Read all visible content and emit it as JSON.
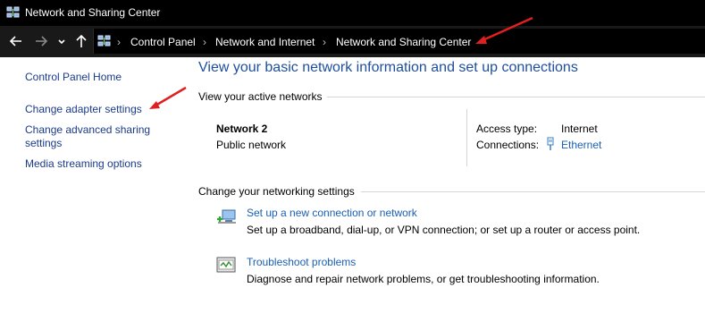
{
  "window": {
    "title": "Network and Sharing Center",
    "icon": "network-center-icon"
  },
  "nav": {
    "back_icon": "back-arrow-icon",
    "forward_icon": "forward-arrow-icon",
    "recent_icon": "chevron-down-icon",
    "up_icon": "up-arrow-icon",
    "breadcrumb": [
      "Control Panel",
      "Network and Internet",
      "Network and Sharing Center"
    ]
  },
  "sidebar": {
    "items": [
      {
        "label": "Control Panel Home"
      },
      {
        "label": "Change adapter settings"
      },
      {
        "label": "Change advanced sharing settings"
      },
      {
        "label": "Media streaming options"
      }
    ]
  },
  "main": {
    "heading": "View your basic network information and set up connections",
    "active_label": "View your active networks",
    "network": {
      "name": "Network 2",
      "type": "Public network",
      "access_type_label": "Access type:",
      "access_type_value": "Internet",
      "connections_label": "Connections:",
      "connections_value": "Ethernet"
    },
    "change_label": "Change your networking settings",
    "tasks": [
      {
        "icon": "new-connection-icon",
        "link": "Set up a new connection or network",
        "desc": "Set up a broadband, dial-up, or VPN connection; or set up a router or access point."
      },
      {
        "icon": "troubleshoot-icon",
        "link": "Troubleshoot problems",
        "desc": "Diagnose and repair network problems, or get troubleshooting information."
      }
    ]
  },
  "annotation_color": "#e02020"
}
